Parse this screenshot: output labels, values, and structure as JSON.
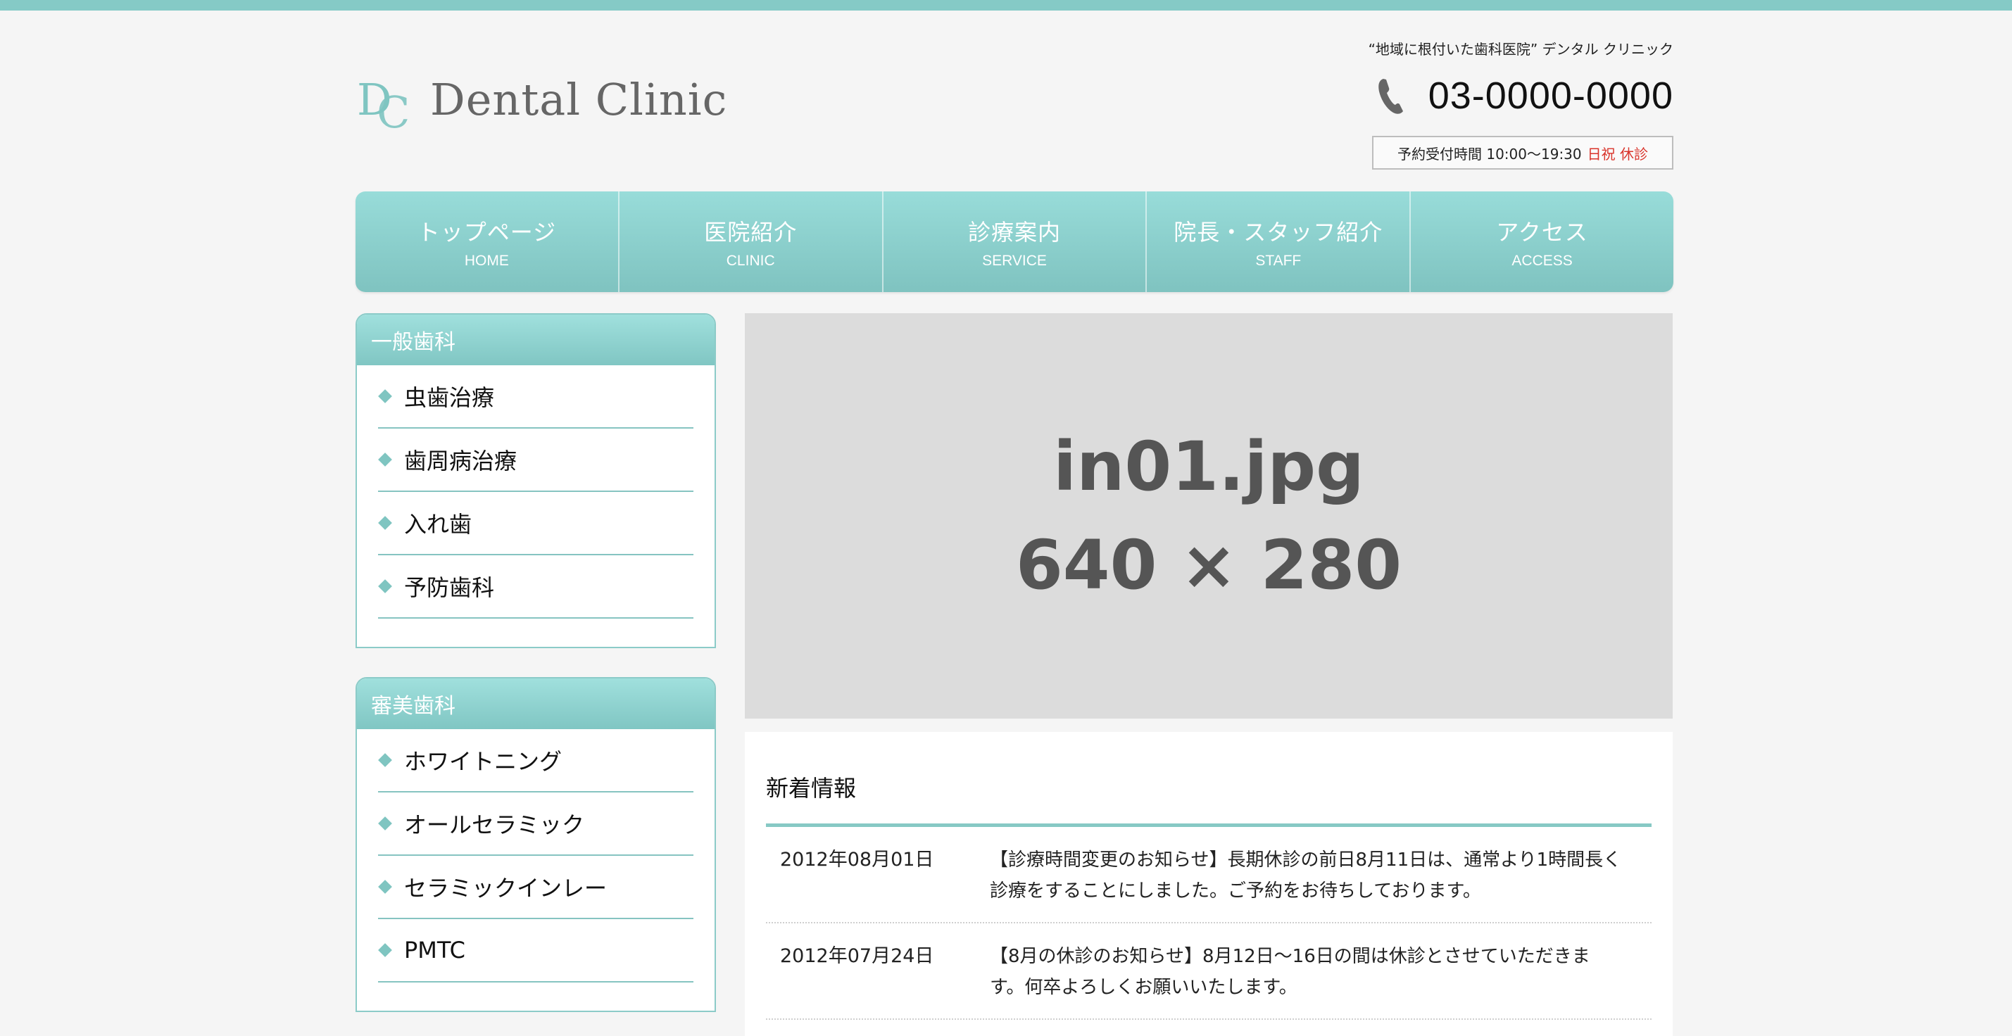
{
  "header": {
    "logo_text": "Dental Clinic",
    "tagline": "“地域に根付いた歯科医院” デンタル クリニック",
    "phone": "03-0000-0000",
    "hours": "予約受付時間 10:00〜19:30",
    "closed": "日祝 休診"
  },
  "nav": [
    {
      "jp": "トップページ",
      "en": "HOME"
    },
    {
      "jp": "医院紹介",
      "en": "CLINIC"
    },
    {
      "jp": "診療案内",
      "en": "SERVICE"
    },
    {
      "jp": "院長・スタッフ紹介",
      "en": "STAFF"
    },
    {
      "jp": "アクセス",
      "en": "ACCESS"
    }
  ],
  "sidebar": [
    {
      "title": "一般歯科",
      "items": [
        "虫歯治療",
        "歯周病治療",
        "入れ歯",
        "予防歯科"
      ]
    },
    {
      "title": "審美歯科",
      "items": [
        "ホワイトニング",
        "オールセラミック",
        "セラミックインレー",
        "PMTC"
      ]
    }
  ],
  "hero": {
    "line1": "in01.jpg",
    "line2": "640 × 280"
  },
  "news": {
    "title": "新着情報",
    "items": [
      {
        "date": "2012年08月01日",
        "text": "【診療時間変更のお知らせ】長期休診の前日8月11日は、通常より1時間長く診療をすることにしました。ご予約をお待ちしております。"
      },
      {
        "date": "2012年07月24日",
        "text": "【8月の休診のお知らせ】8月12日〜16日の間は休診とさせていただきます。何卒よろしくお願いいたします。"
      }
    ]
  },
  "colors": {
    "accent": "#85cac6",
    "closed": "#d9342b"
  },
  "icons": {
    "phone": "phone-icon",
    "logo": "dc-logo-mark",
    "bullet": "diamond-bullet-icon"
  }
}
